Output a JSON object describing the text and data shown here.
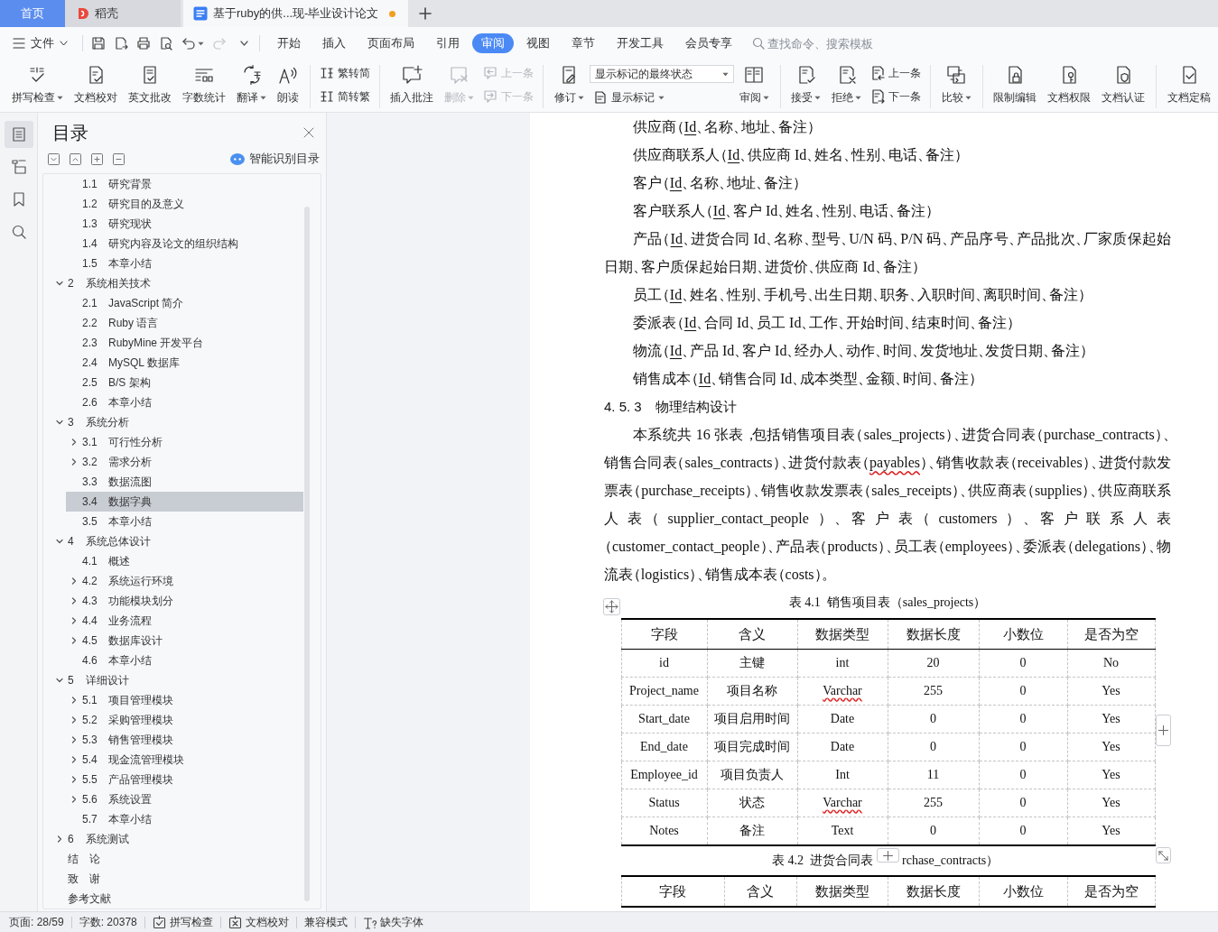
{
  "tabs": [
    {
      "kind": "home",
      "label": "首页",
      "selected": false,
      "modified": false
    },
    {
      "kind": "service",
      "label": "稻壳",
      "selected": false,
      "modified": false
    },
    {
      "kind": "document",
      "label": "基于ruby的供...现-毕业设计论文",
      "selected": true,
      "modified": true
    }
  ],
  "menu": {
    "file": "文件",
    "quick_access": [
      {
        "disabled": false,
        "dropdown": false
      },
      {
        "disabled": false,
        "dropdown": false
      },
      {
        "disabled": false,
        "dropdown": false
      },
      {
        "disabled": false,
        "dropdown": false
      },
      {
        "disabled": false,
        "dropdown": true
      },
      {
        "disabled": true,
        "dropdown": false
      }
    ],
    "tabs": [
      {
        "label": "开始",
        "selected": false
      },
      {
        "label": "插入",
        "selected": false
      },
      {
        "label": "页面布局",
        "selected": false
      },
      {
        "label": "引用",
        "selected": false
      },
      {
        "label": "审阅",
        "selected": true
      },
      {
        "label": "视图",
        "selected": false
      },
      {
        "label": "章节",
        "selected": false
      },
      {
        "label": "开发工具",
        "selected": false
      },
      {
        "label": "会员专享",
        "selected": false
      }
    ],
    "search": {
      "placeholder": "查找命令、搜索模板"
    }
  },
  "ribbon": [
    {
      "controls": [
        {
          "kind": "large",
          "label": "拼写检查",
          "dropdown": true,
          "disabled": false
        },
        {
          "kind": "large",
          "label": "文档校对",
          "dropdown": false,
          "disabled": false
        },
        {
          "kind": "large",
          "label": "英文批改",
          "dropdown": false,
          "disabled": false
        },
        {
          "kind": "large",
          "label": "字数统计",
          "dropdown": false,
          "disabled": false
        },
        {
          "kind": "large",
          "label": "翻译",
          "dropdown": true,
          "disabled": false
        },
        {
          "kind": "large",
          "label": "朗读",
          "dropdown": false,
          "disabled": false
        }
      ]
    },
    {
      "controls": [
        {
          "kind": "stack",
          "items": [
            {
              "label": "繁转简",
              "disabled": false
            },
            {
              "label": "简转繁",
              "disabled": false
            }
          ]
        }
      ]
    },
    {
      "controls": [
        {
          "kind": "large",
          "label": "插入批注",
          "dropdown": false,
          "disabled": false
        },
        {
          "kind": "large",
          "label": "删除",
          "dropdown": true,
          "disabled": true
        },
        {
          "kind": "stack",
          "items": [
            {
              "label": "上一条",
              "disabled": true
            },
            {
              "label": "下一条",
              "disabled": true
            }
          ]
        }
      ]
    },
    {
      "controls": [
        {
          "kind": "large",
          "label": "修订",
          "dropdown": true,
          "disabled": false
        },
        {
          "kind": "display",
          "select": {
            "value": "显示标记的最终状态"
          },
          "button": {
            "label": "显示标记",
            "dropdown": true
          }
        },
        {
          "kind": "large",
          "label": "审阅",
          "dropdown": true,
          "disabled": false
        }
      ]
    },
    {
      "controls": [
        {
          "kind": "large",
          "label": "接受",
          "dropdown": true,
          "disabled": false
        },
        {
          "kind": "large",
          "label": "拒绝",
          "dropdown": true,
          "disabled": false
        },
        {
          "kind": "stack",
          "items": [
            {
              "label": "上一条",
              "disabled": false
            },
            {
              "label": "下一条",
              "disabled": false
            }
          ]
        }
      ]
    },
    {
      "controls": [
        {
          "kind": "large",
          "label": "比较",
          "dropdown": true,
          "disabled": false
        }
      ]
    },
    {
      "controls": [
        {
          "kind": "large",
          "label": "限制编辑",
          "dropdown": false,
          "disabled": false
        },
        {
          "kind": "large",
          "label": "文档权限",
          "dropdown": false,
          "disabled": false
        },
        {
          "kind": "large",
          "label": "文档认证",
          "dropdown": false,
          "disabled": false
        }
      ]
    },
    {
      "controls": [
        {
          "kind": "large",
          "label": "文档定稿",
          "dropdown": false,
          "disabled": false
        }
      ]
    }
  ],
  "nav_rail": [
    {
      "selected": true
    },
    {
      "selected": false
    },
    {
      "selected": false
    },
    {
      "selected": false
    }
  ],
  "toc": {
    "title": "目录",
    "smart_button": "智能识别目录",
    "continued_items": [
      {
        "kind": "leaf",
        "number": "1.1",
        "title": "研究背景",
        "selected": false
      },
      {
        "kind": "leaf",
        "number": "1.2",
        "title": "研究目的及意义",
        "selected": false
      },
      {
        "kind": "leaf",
        "number": "1.3",
        "title": "研究现状",
        "selected": false
      },
      {
        "kind": "leaf",
        "number": "1.4",
        "title": "研究内容及论文的组织结构",
        "selected": false
      },
      {
        "kind": "leaf",
        "number": "1.5",
        "title": "本章小结",
        "selected": false
      }
    ],
    "items": [
      {
        "kind": "branch",
        "number": "2",
        "title": "系统相关技术",
        "expanded": true,
        "selected": false,
        "children": [
          {
            "kind": "leaf",
            "number": "2.1",
            "title": "JavaScript 简介",
            "selected": false
          },
          {
            "kind": "leaf",
            "number": "2.2",
            "title": "Ruby 语言",
            "selected": false
          },
          {
            "kind": "leaf",
            "number": "2.3",
            "title": "RubyMine 开发平台",
            "selected": false
          },
          {
            "kind": "leaf",
            "number": "2.4",
            "title": "MySQL 数据库",
            "selected": false
          },
          {
            "kind": "leaf",
            "number": "2.5",
            "title": "B/S 架构",
            "selected": false
          },
          {
            "kind": "leaf",
            "number": "2.6",
            "title": "本章小结",
            "selected": false
          }
        ]
      },
      {
        "kind": "branch",
        "number": "3",
        "title": "系统分析",
        "expanded": true,
        "selected": false,
        "children": [
          {
            "kind": "branch",
            "number": "3.1",
            "title": "可行性分析",
            "expanded": false,
            "selected": false
          },
          {
            "kind": "branch",
            "number": "3.2",
            "title": "需求分析",
            "expanded": false,
            "selected": false
          },
          {
            "kind": "leaf",
            "number": "3.3",
            "title": "数据流图",
            "selected": false
          },
          {
            "kind": "leaf",
            "number": "3.4",
            "title": "数据字典",
            "selected": true
          },
          {
            "kind": "leaf",
            "number": "3.5",
            "title": "本章小结",
            "selected": false
          }
        ]
      },
      {
        "kind": "branch",
        "number": "4",
        "title": "系统总体设计",
        "expanded": true,
        "selected": false,
        "children": [
          {
            "kind": "leaf",
            "number": "4.1",
            "title": "概述",
            "selected": false
          },
          {
            "kind": "branch",
            "number": "4.2",
            "title": "系统运行环境",
            "expanded": false,
            "selected": false
          },
          {
            "kind": "branch",
            "number": "4.3",
            "title": "功能模块划分",
            "expanded": false,
            "selected": false
          },
          {
            "kind": "branch",
            "number": "4.4",
            "title": "业务流程",
            "expanded": false,
            "selected": false
          },
          {
            "kind": "branch",
            "number": "4.5",
            "title": "数据库设计",
            "expanded": false,
            "selected": false
          },
          {
            "kind": "leaf",
            "number": "4.6",
            "title": "本章小结",
            "selected": false
          }
        ]
      },
      {
        "kind": "branch",
        "number": "5",
        "title": "详细设计",
        "expanded": true,
        "selected": false,
        "children": [
          {
            "kind": "branch",
            "number": "5.1",
            "title": "项目管理模块",
            "expanded": false,
            "selected": false
          },
          {
            "kind": "branch",
            "number": "5.2",
            "title": "采购管理模块",
            "expanded": false,
            "selected": false
          },
          {
            "kind": "branch",
            "number": "5.3",
            "title": "销售管理模块",
            "expanded": false,
            "selected": false
          },
          {
            "kind": "branch",
            "number": "5.4",
            "title": "现金流管理模块",
            "expanded": false,
            "selected": false
          },
          {
            "kind": "branch",
            "number": "5.5",
            "title": "产品管理模块",
            "expanded": false,
            "selected": false
          },
          {
            "kind": "branch",
            "number": "5.6",
            "title": "系统设置",
            "expanded": false,
            "selected": false
          },
          {
            "kind": "leaf",
            "number": "5.7",
            "title": "本章小结",
            "selected": false
          }
        ]
      },
      {
        "kind": "branch",
        "number": "6",
        "title": "系统测试",
        "expanded": false,
        "selected": false
      },
      {
        "kind": "leaf",
        "title": "结　论",
        "selected": false
      },
      {
        "kind": "leaf",
        "title": "致　谢",
        "selected": false
      },
      {
        "kind": "leaf",
        "title": "参考文献",
        "selected": false
      }
    ]
  },
  "document": {
    "blocks": [
      {
        "kind": "body",
        "runs": [
          {
            "kind": "plain",
            "text": "供应商（"
          },
          {
            "kind": "key",
            "text": "Id"
          },
          {
            "kind": "plain",
            "text": "、名称、地址、备注）"
          }
        ]
      },
      {
        "kind": "body",
        "runs": [
          {
            "kind": "plain",
            "text": "供应商联系人（"
          },
          {
            "kind": "key",
            "text": "Id"
          },
          {
            "kind": "plain",
            "text": "、供应商 Id、姓名、性别、电话、备注）"
          }
        ]
      },
      {
        "kind": "body",
        "runs": [
          {
            "kind": "plain",
            "text": "客户（"
          },
          {
            "kind": "key",
            "text": "Id"
          },
          {
            "kind": "plain",
            "text": "、名称、地址、备注）"
          }
        ]
      },
      {
        "kind": "body",
        "runs": [
          {
            "kind": "plain",
            "text": "客户联系人（"
          },
          {
            "kind": "key",
            "text": "Id"
          },
          {
            "kind": "plain",
            "text": "、客户 Id、姓名、性别、电话、备注）"
          }
        ]
      },
      {
        "kind": "body",
        "runs": [
          {
            "kind": "plain",
            "text": "产品（"
          },
          {
            "kind": "key",
            "text": "Id"
          },
          {
            "kind": "plain",
            "text": "、进货合同 Id、名称、型号、U/N 码、P/N 码、产品序号、产品批次、厂家质保起始日期、客户质保起始日期、进货价、供应商 Id、备注）"
          }
        ]
      },
      {
        "kind": "body",
        "runs": [
          {
            "kind": "plain",
            "text": "员工（"
          },
          {
            "kind": "key",
            "text": "Id"
          },
          {
            "kind": "plain",
            "text": "、姓名、性别、手机号、出生日期、职务、入职时间、离职时间、备注）"
          }
        ]
      },
      {
        "kind": "body",
        "runs": [
          {
            "kind": "plain",
            "text": "委派表（"
          },
          {
            "kind": "key",
            "text": "Id"
          },
          {
            "kind": "plain",
            "text": "、合同 Id、员工 Id、工作、开始时间、结束时间、备注）"
          }
        ]
      },
      {
        "kind": "body",
        "runs": [
          {
            "kind": "plain",
            "text": "物流（"
          },
          {
            "kind": "key",
            "text": "Id"
          },
          {
            "kind": "plain",
            "text": "、产品 Id、客户 Id、经办人、动作、时间、发货地址、发货日期、备注）"
          }
        ]
      },
      {
        "kind": "body",
        "runs": [
          {
            "kind": "plain",
            "text": "销售成本（"
          },
          {
            "kind": "key",
            "text": "Id"
          },
          {
            "kind": "plain",
            "text": "、销售合同 Id、成本类型、金额、时间、备注）"
          }
        ]
      },
      {
        "kind": "heading",
        "runs": [
          {
            "kind": "plain",
            "text": "4. 5. 3　物理结构设计"
          }
        ]
      },
      {
        "kind": "body",
        "runs": [
          {
            "kind": "plain",
            "text": "本系统共 16 张表，包括销售项目表（sales_projects）、进货合同表（purchase_contracts）、销售合同表（sales_contracts）、进货付款表（"
          },
          {
            "kind": "misspelled",
            "text": "payables"
          },
          {
            "kind": "plain",
            "text": "）、销售收款表（receivables）、进货付款发票表（purchase_receipts）、销售收款发票表（sales_receipts）、供应商表（supplies）、供应商联系人表（supplier_contact_people）、客户表（customers）、客户联系人表（customer_contact_people）、产品表（products）、员工表（employees）、委派表（delegations）、物流表（logistics）、销售成本表（costs）。"
          }
        ]
      },
      {
        "kind": "table",
        "active": true,
        "caption": [
          "表 4.1  销售项目表（sales_projects）"
        ],
        "columns": [
          "字段",
          "含义",
          "数据类型",
          "数据长度",
          "小数位",
          "是否为空"
        ],
        "rows": [
          [
            {
              "text": "id",
              "misspelled": false
            },
            {
              "text": "主键",
              "misspelled": false
            },
            {
              "text": "int",
              "misspelled": false
            },
            {
              "text": "20",
              "misspelled": false
            },
            {
              "text": "0",
              "misspelled": false
            },
            {
              "text": "No",
              "misspelled": false
            }
          ],
          [
            {
              "text": "Project_name",
              "misspelled": false
            },
            {
              "text": "项目名称",
              "misspelled": false
            },
            {
              "text": "Varchar",
              "misspelled": true
            },
            {
              "text": "255",
              "misspelled": false
            },
            {
              "text": "0",
              "misspelled": false
            },
            {
              "text": "Yes",
              "misspelled": false
            }
          ],
          [
            {
              "text": "Start_date",
              "misspelled": false
            },
            {
              "text": "项目启用时间",
              "misspelled": false
            },
            {
              "text": "Date",
              "misspelled": false
            },
            {
              "text": "0",
              "misspelled": false
            },
            {
              "text": "0",
              "misspelled": false
            },
            {
              "text": "Yes",
              "misspelled": false
            }
          ],
          [
            {
              "text": "End_date",
              "misspelled": false
            },
            {
              "text": "项目完成时间",
              "misspelled": false
            },
            {
              "text": "Date",
              "misspelled": false
            },
            {
              "text": "0",
              "misspelled": false
            },
            {
              "text": "0",
              "misspelled": false
            },
            {
              "text": "Yes",
              "misspelled": false
            }
          ],
          [
            {
              "text": "Employee_id",
              "misspelled": false
            },
            {
              "text": "项目负责人",
              "misspelled": false
            },
            {
              "text": "Int",
              "misspelled": false
            },
            {
              "text": "11",
              "misspelled": false
            },
            {
              "text": "0",
              "misspelled": false
            },
            {
              "text": "Yes",
              "misspelled": false
            }
          ],
          [
            {
              "text": "Status",
              "misspelled": false
            },
            {
              "text": "状态",
              "misspelled": false
            },
            {
              "text": "Varchar",
              "misspelled": true
            },
            {
              "text": "255",
              "misspelled": false
            },
            {
              "text": "0",
              "misspelled": false
            },
            {
              "text": "Yes",
              "misspelled": false
            }
          ],
          [
            {
              "text": "Notes",
              "misspelled": false
            },
            {
              "text": "备注",
              "misspelled": false
            },
            {
              "text": "Text",
              "misspelled": false
            },
            {
              "text": "0",
              "misspelled": false
            },
            {
              "text": "0",
              "misspelled": false
            },
            {
              "text": "Yes",
              "misspelled": false
            }
          ]
        ]
      },
      {
        "kind": "table",
        "active": false,
        "caption": [
          "表 4.2  进货合同表",
          "rchase_contracts）"
        ],
        "columns": [
          "字段",
          "含义",
          "数据类型",
          "数据长度",
          "小数位",
          "是否为空"
        ]
      }
    ]
  },
  "status_bar": [
    {
      "kind": "text",
      "text": "页面: 28/59"
    },
    {
      "kind": "text",
      "text": "字数: 20378"
    },
    {
      "kind": "button",
      "text": "拼写检查"
    },
    {
      "kind": "button",
      "text": "文档校对"
    },
    {
      "kind": "text",
      "text": "兼容模式"
    },
    {
      "kind": "button",
      "text": "缺失字体"
    }
  ]
}
